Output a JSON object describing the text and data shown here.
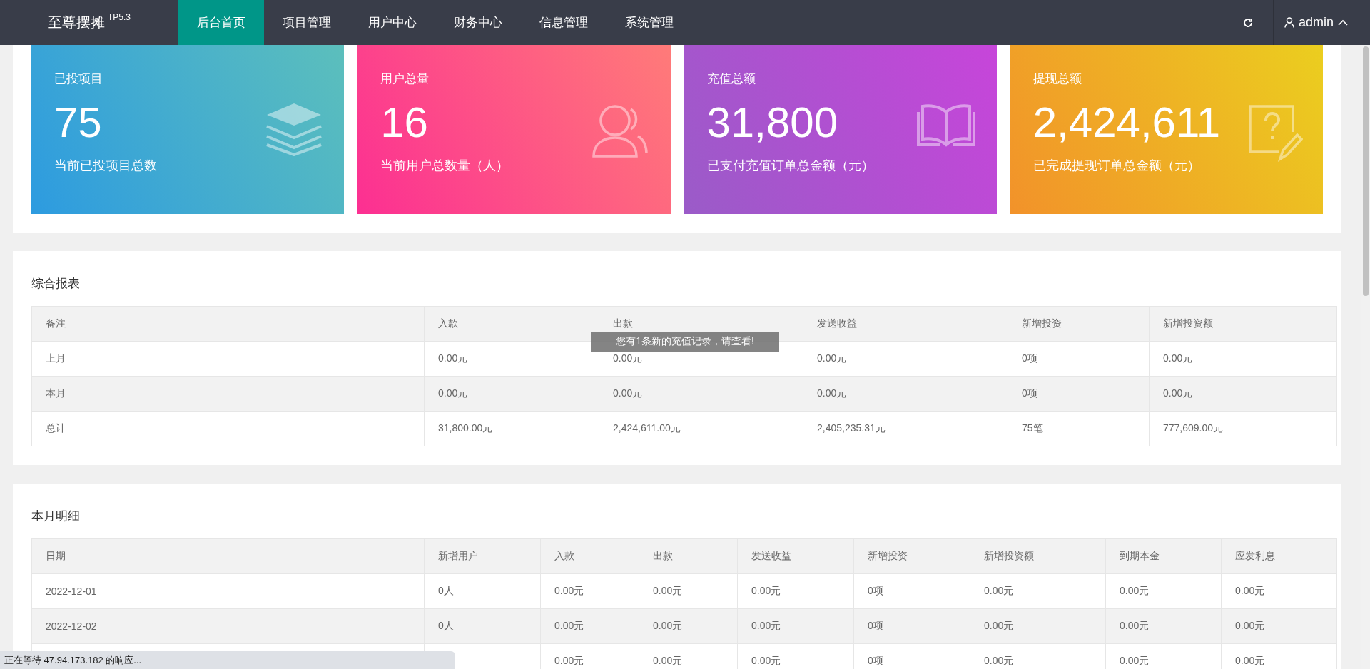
{
  "app": {
    "logo": "至尊摆摊",
    "version": "TP5.3"
  },
  "nav": [
    {
      "label": "后台首页",
      "selected": true
    },
    {
      "label": "项目管理",
      "selected": false
    },
    {
      "label": "用户中心",
      "selected": false
    },
    {
      "label": "财务中心",
      "selected": false
    },
    {
      "label": "信息管理",
      "selected": false
    },
    {
      "label": "系统管理",
      "selected": false
    }
  ],
  "user": {
    "name": "admin"
  },
  "stats": [
    {
      "kind": "layers",
      "title": "已投项目",
      "value": "75",
      "caption": "当前已投项目总数"
    },
    {
      "kind": "users",
      "title": "用户总量",
      "value": "16",
      "caption": "当前用户总数量（人）"
    },
    {
      "kind": "book",
      "title": "充值总额",
      "value": "31,800",
      "caption": "已支付充值订单总金额（元）"
    },
    {
      "kind": "note",
      "title": "提现总额",
      "value": "2,424,611",
      "caption": "已完成提现订单总金额（元）"
    }
  ],
  "summary": {
    "title": "综合报表",
    "columns": [
      "备注",
      "入款",
      "出款",
      "发送收益",
      "新增投资",
      "新增投资额"
    ],
    "rows": [
      [
        "上月",
        "0.00元",
        "0.00元",
        "0.00元",
        "0项",
        "0.00元"
      ],
      [
        "本月",
        "0.00元",
        "0.00元",
        "0.00元",
        "0项",
        "0.00元"
      ],
      [
        "总计",
        "31,800.00元",
        "2,424,611.00元",
        "2,405,235.31元",
        "75笔",
        "777,609.00元"
      ]
    ]
  },
  "monthly": {
    "title": "本月明细",
    "columns": [
      "日期",
      "新增用户",
      "入款",
      "出款",
      "发送收益",
      "新增投资",
      "新增投资额",
      "到期本金",
      "应发利息"
    ],
    "rows": [
      [
        "2022-12-01",
        "0人",
        "0.00元",
        "0.00元",
        "0.00元",
        "0项",
        "0.00元",
        "0.00元",
        "0.00元"
      ],
      [
        "2022-12-02",
        "0人",
        "0.00元",
        "0.00元",
        "0.00元",
        "0项",
        "0.00元",
        "0.00元",
        "0.00元"
      ],
      [
        null,
        null,
        "0.00元",
        "0.00元",
        "0.00元",
        "0项",
        "0.00元",
        "0.00元",
        "0.00元"
      ]
    ]
  },
  "toast": {
    "message": "您有1条新的充值记录，请查看!"
  },
  "status_bar": {
    "text": "正在等待 47.94.173.182 的响应..."
  }
}
